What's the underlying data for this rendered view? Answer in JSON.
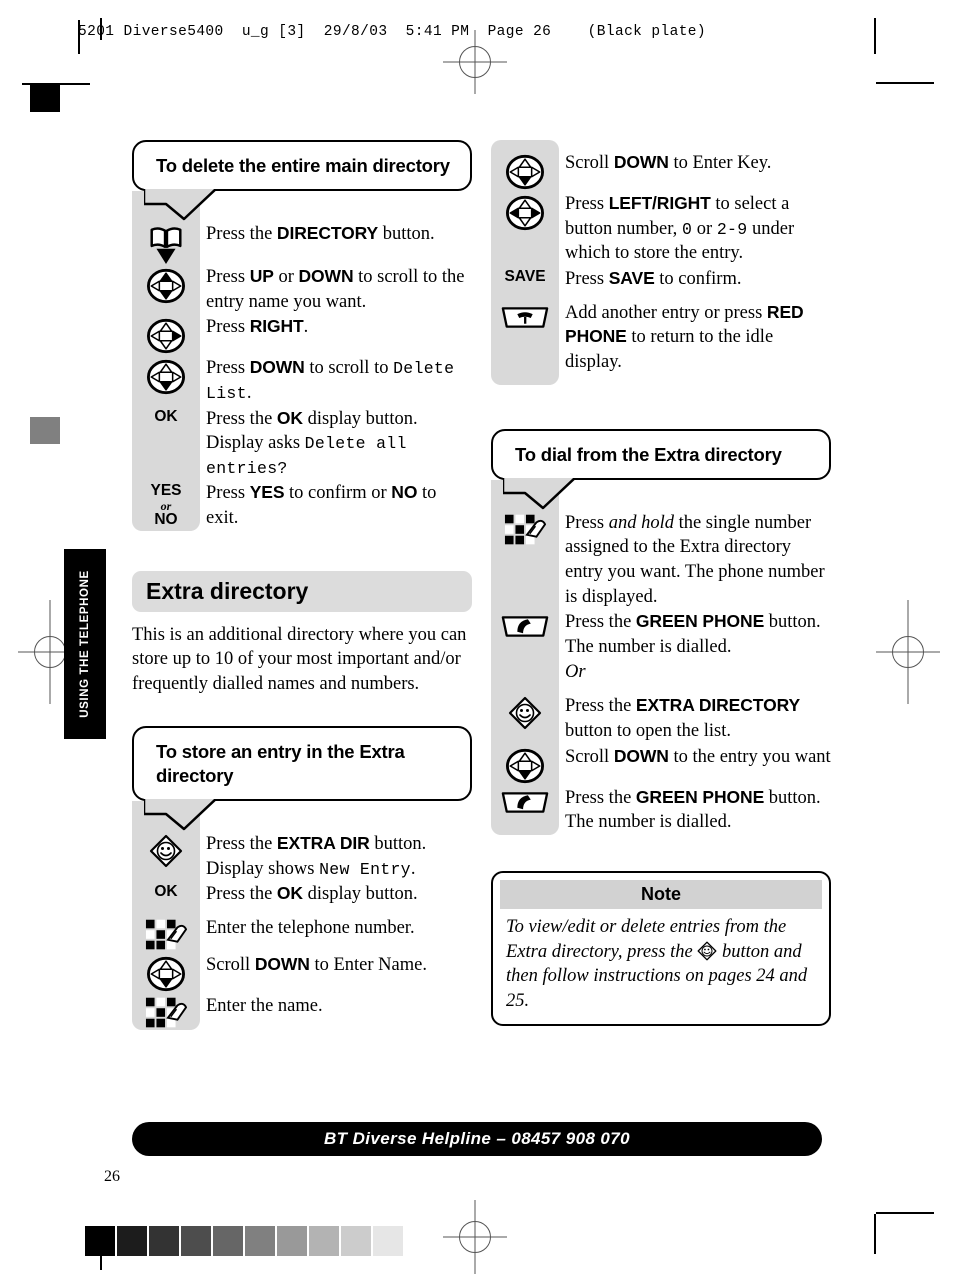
{
  "print_slug": "5201 Diverse5400  u_g [3]  29/8/03  5:41 PM  Page 26    (Black plate)",
  "side_tab": "USING THE TELEPHONE",
  "page_number": "26",
  "helpline": "BT Diverse Helpline – 08457 908 070",
  "left_column": {
    "bubble1_title": "To delete the entire main directory",
    "steps1": [
      {
        "icon": "directory-book-icon",
        "label": "",
        "text_html": "Press the <b>DIRECTORY</b> button."
      },
      {
        "icon": "dpad-updown-icon",
        "label": "",
        "text_html": "Press <b>UP</b> or <b>DOWN</b> to scroll to the entry name you want."
      },
      {
        "icon": "dpad-right-icon",
        "label": "",
        "text_html": "Press <b>RIGHT</b>."
      },
      {
        "icon": "dpad-down-icon",
        "label": "",
        "text_html": "Press <b>DOWN</b> to scroll to <span class=\"lcd\">Delete List</span>."
      },
      {
        "icon": "text-label",
        "label": "OK",
        "text_html": "Press the <b>OK</b> display button. Display asks <span class=\"lcd\">Delete all entries?</span>"
      },
      {
        "icon": "text-label-yesno",
        "label": "YES|or|NO",
        "text_html": "Press <b>YES</b> to confirm or <b>NO</b> to exit."
      }
    ],
    "section_heading": "Extra directory",
    "section_body": "This is an additional directory where you can store up to 10 of your most important and/or frequently dialled names and numbers.",
    "bubble2_title": "To store an entry in the Extra directory",
    "steps2": [
      {
        "icon": "extra-dir-icon",
        "label": "",
        "text_html": "Press the <b>EXTRA DIR</b> button. Display shows <span class=\"lcd\">New Entry</span>."
      },
      {
        "icon": "text-label",
        "label": "OK",
        "text_html": "Press the <b>OK</b> display button."
      },
      {
        "icon": "keypad-icon",
        "label": "",
        "text_html": "Enter the telephone number."
      },
      {
        "icon": "dpad-down-icon",
        "label": "",
        "text_html": "Scroll <b>DOWN</b> to Enter Name."
      },
      {
        "icon": "keypad-icon",
        "label": "",
        "text_html": "Enter the name."
      }
    ]
  },
  "right_column": {
    "steps1": [
      {
        "icon": "dpad-down-icon",
        "label": "",
        "text_html": "Scroll <b>DOWN</b> to Enter Key."
      },
      {
        "icon": "dpad-leftright-icon",
        "label": "",
        "text_html": "Press <b>LEFT/RIGHT</b> to select a button number, <span class=\"lcd\">0</span> or <span class=\"lcd\">2-9</span> under which to store the entry."
      },
      {
        "icon": "text-label",
        "label": "SAVE",
        "text_html": "Press <b>SAVE</b> to confirm."
      },
      {
        "icon": "red-phone-icon",
        "label": "",
        "text_html": "Add another entry or press <b>RED PHONE</b> to return to the idle display."
      }
    ],
    "bubble1_title": "To dial from the Extra directory",
    "steps2": [
      {
        "icon": "keypad-icon",
        "label": "",
        "text_html": "Press <i class=\"em\">and hold</i> the single number assigned to the Extra directory entry you want. The phone number is displayed."
      },
      {
        "icon": "green-phone-icon",
        "label": "",
        "text_html": "Press the <b>GREEN PHONE</b> button. The number is dialled."
      },
      {
        "icon": "none",
        "label": "",
        "text_html": "<i class=\"em\">Or</i>"
      },
      {
        "icon": "extra-dir-icon",
        "label": "",
        "text_html": "Press the <b>EXTRA DIRECTORY</b> button to open the list."
      },
      {
        "icon": "dpad-down-icon",
        "label": "",
        "text_html": "Scroll <b>DOWN</b> to the entry you want"
      },
      {
        "icon": "green-phone-icon",
        "label": "",
        "text_html": "Press the <b>GREEN PHONE</b> button. The number is dialled."
      }
    ],
    "note_heading": "Note",
    "note_body_html": "To view/edit or delete entries from the Extra directory, press the <span class=\"inline-extra\"></span> button and then follow instructions on pages 24 and 25."
  },
  "grayscale_swatches": [
    "#000000",
    "#1c1c1c",
    "#333333",
    "#4d4d4d",
    "#666666",
    "#808080",
    "#999999",
    "#b3b3b3",
    "#cccccc",
    "#e6e6e6"
  ]
}
